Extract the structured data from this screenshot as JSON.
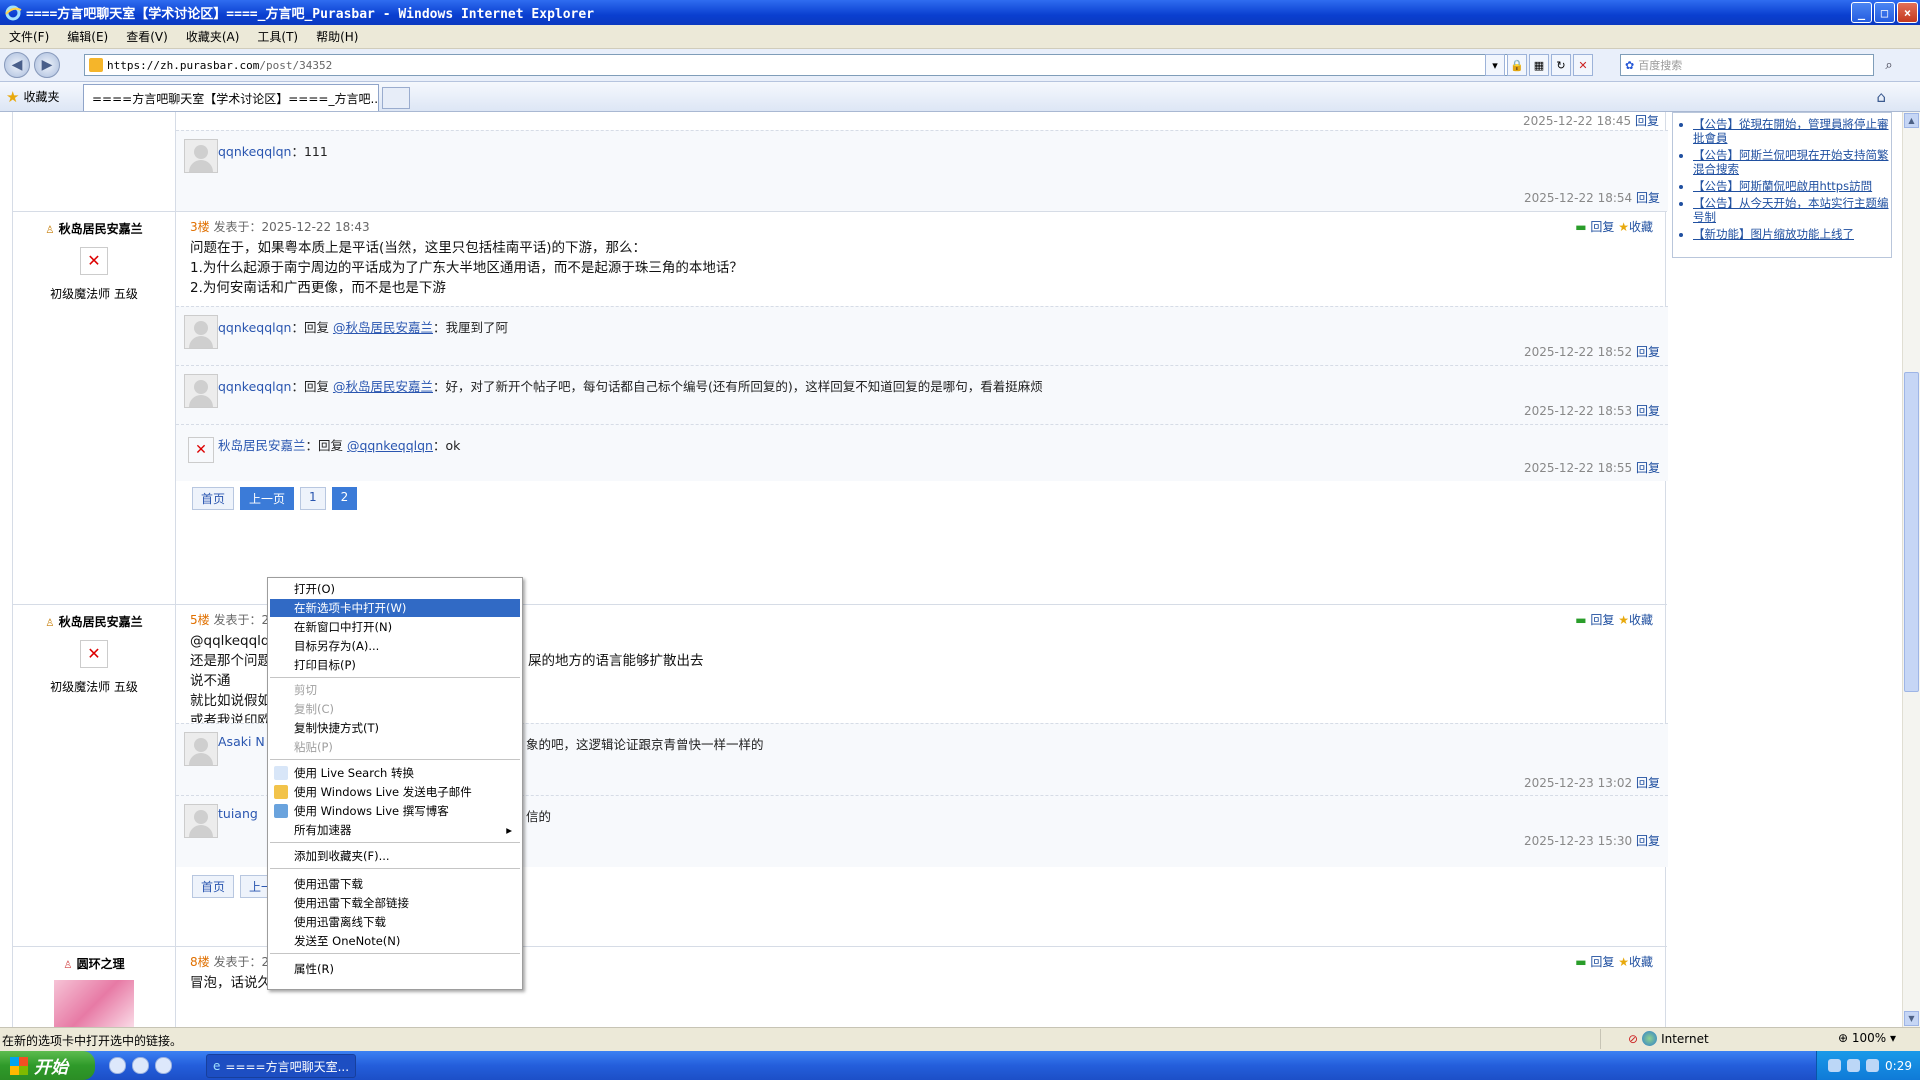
{
  "window": {
    "title": "====方言吧聊天室【学术讨论区】====_方言吧_Purasbar - Windows Internet Explorer",
    "buttons": {
      "minimize": "_",
      "maximize": "□",
      "close": "×"
    }
  },
  "menu": [
    "文件(F)",
    "编辑(E)",
    "查看(V)",
    "收藏夹(A)",
    "工具(T)",
    "帮助(H)"
  ],
  "address": {
    "scheme": "https",
    "host": "://zh.purasbar.com",
    "path": "/post/34352"
  },
  "search": {
    "placeholder": "百度搜索"
  },
  "favbar": {
    "favorites_label": "收藏夹",
    "tab_title": "====方言吧聊天室【学术讨论区】====_方言吧..."
  },
  "posts": {
    "top_time": "2025-12-22 18:45",
    "top_reply": {
      "user": "qqnkeqqlqn",
      "text": "：111",
      "time": "2025-12-22 18:54"
    },
    "floor3": {
      "author": "秋岛居民安嘉兰",
      "level": "初级魔法师 五级",
      "floor": "3楼",
      "posted": " 发表于：2025-12-22 18:43",
      "actions": {
        "reply": "回复",
        "favorite": "收藏"
      },
      "lines": [
        "问题在于，如果粤本质上是平话(当然，这里只包括桂南平话)的下游，那么：",
        "1.为什么起源于南宁周边的平话成为了广东大半地区通用语，而不是起源于珠三角的本地话？",
        "2.为何安南话和广西更像，而不是也是下游"
      ],
      "replies": [
        {
          "user": "qqnkeqqlqn",
          "prefix": "：回复 ",
          "mention": "@秋岛居民安嘉兰",
          "text": "：我厘到了阿",
          "time": "2025-12-22 18:52"
        },
        {
          "user": "qqnkeqqlqn",
          "prefix": "：回复 ",
          "mention": "@秋岛居民安嘉兰",
          "text": "：好，对了新开个帖子吧，每句话都自己标个编号(还有所回复的)，这样回复不知道回复的是哪句，看着挺麻烦",
          "time": "2025-12-22 18:53"
        },
        {
          "user": "秋岛居民安嘉兰",
          "prefix": "：回复 ",
          "mention": "@qqnkeqqlqn",
          "text": "：ok",
          "time": "2025-12-22 18:55"
        }
      ],
      "pager": [
        "首页",
        "上一页",
        "1",
        "2"
      ]
    },
    "floor5": {
      "author": "秋岛居民安嘉兰",
      "level": "初级魔法师 五级",
      "floor": "5楼",
      "posted": " 发表于：2",
      "lines": [
        "@qqlkeqqlq",
        "还是那个问题",
        "说不通",
        "就比如说假如",
        "或者我说印欧"
      ],
      "line2_tail": "屎的地方的语言能够扩散出去",
      "replies": [
        {
          "user": "Asaki N",
          "tail": "象的吧，这逻辑论证跟京青曾快一样一样的",
          "time": "2025-12-23 13:02"
        },
        {
          "user": "tuiang",
          "tail": "信的",
          "time": "2025-12-23 15:30"
        }
      ],
      "pager": [
        "首页",
        "上一"
      ]
    },
    "floor8": {
      "author": "圆环之理",
      "floor": "8楼",
      "posted": " 发表于：2",
      "text": "冒泡，话说久违新朋友"
    }
  },
  "reply_label": "回复",
  "sidebar": [
    "【公告】從現在開始，管理員將停止審批會員",
    "【公告】阿斯兰侃吧現在开始支持简繁混合搜索",
    "【公告】阿斯蘭侃吧啟用https訪問",
    "【公告】从今天开始，本站实行主题编号制",
    "【新功能】图片缩放功能上线了"
  ],
  "context_menu": {
    "items": [
      {
        "label": "打开(O)",
        "state": "normal"
      },
      {
        "label": "在新选项卡中打开(W)",
        "state": "highlighted"
      },
      {
        "label": "在新窗口中打开(N)",
        "state": "normal"
      },
      {
        "label": "目标另存为(A)...",
        "state": "normal"
      },
      {
        "label": "打印目标(P)",
        "state": "normal"
      },
      {
        "label": "剪切",
        "state": "disabled"
      },
      {
        "label": "复制(C)",
        "state": "disabled"
      },
      {
        "label": "复制快捷方式(T)",
        "state": "normal"
      },
      {
        "label": "粘贴(P)",
        "state": "disabled"
      },
      {
        "label": "使用 Live Search 转换",
        "state": "normal"
      },
      {
        "label": "使用 Windows Live 发送电子邮件",
        "state": "normal"
      },
      {
        "label": "使用 Windows Live 撰写博客",
        "state": "normal"
      },
      {
        "label": "所有加速器",
        "state": "normal"
      },
      {
        "label": "添加到收藏夹(F)...",
        "state": "normal"
      },
      {
        "label": "使用迅雷下载",
        "state": "normal"
      },
      {
        "label": "使用迅雷下载全部链接",
        "state": "normal"
      },
      {
        "label": "使用迅雷离线下载",
        "state": "normal"
      },
      {
        "label": "发送至 OneNote(N)",
        "state": "normal"
      },
      {
        "label": "属性(R)",
        "state": "normal"
      }
    ]
  },
  "status": {
    "message": "在新的选项卡中打开选中的链接。",
    "zone": "Internet",
    "zoom": "100%"
  },
  "taskbar": {
    "start": "开始",
    "task": "====方言吧聊天室...",
    "clock": "0:29"
  },
  "colors": {
    "accent": "#316ac5",
    "link": "#2a56b0",
    "floor": "#e07000"
  }
}
